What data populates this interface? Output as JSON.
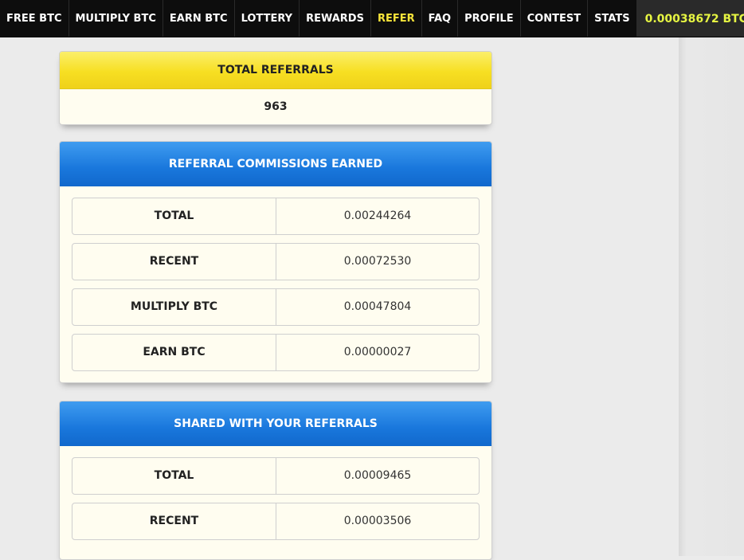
{
  "nav": {
    "items": [
      {
        "label": "FREE BTC"
      },
      {
        "label": "MULTIPLY BTC"
      },
      {
        "label": "EARN BTC"
      },
      {
        "label": "LOTTERY"
      },
      {
        "label": "REWARDS"
      },
      {
        "label": "REFER"
      },
      {
        "label": "FAQ"
      },
      {
        "label": "PROFILE"
      },
      {
        "label": "CONTEST"
      },
      {
        "label": "STATS"
      }
    ],
    "active": "REFER",
    "balance": "0.00038672 BTC"
  },
  "total_referrals": {
    "title": "TOTAL REFERRALS",
    "count": "963"
  },
  "commissions": {
    "title": "REFERRAL COMMISSIONS EARNED",
    "rows": [
      {
        "label": "TOTAL",
        "value": "0.00244264"
      },
      {
        "label": "RECENT",
        "value": "0.00072530"
      },
      {
        "label": "MULTIPLY BTC",
        "value": "0.00047804"
      },
      {
        "label": "EARN BTC",
        "value": "0.00000027"
      }
    ]
  },
  "shared": {
    "title": "SHARED WITH YOUR REFERRALS",
    "rows": [
      {
        "label": "TOTAL",
        "value": "0.00009465"
      },
      {
        "label": "RECENT",
        "value": "0.00003506"
      }
    ]
  },
  "colors": {
    "nav_bg": "#0d0d0d",
    "active_nav": "#f7e43a",
    "balance_text": "#e6f542",
    "yellow_header": "#f7df22",
    "blue_header": "#1977dc",
    "panel_bg": "#fffdf0"
  }
}
